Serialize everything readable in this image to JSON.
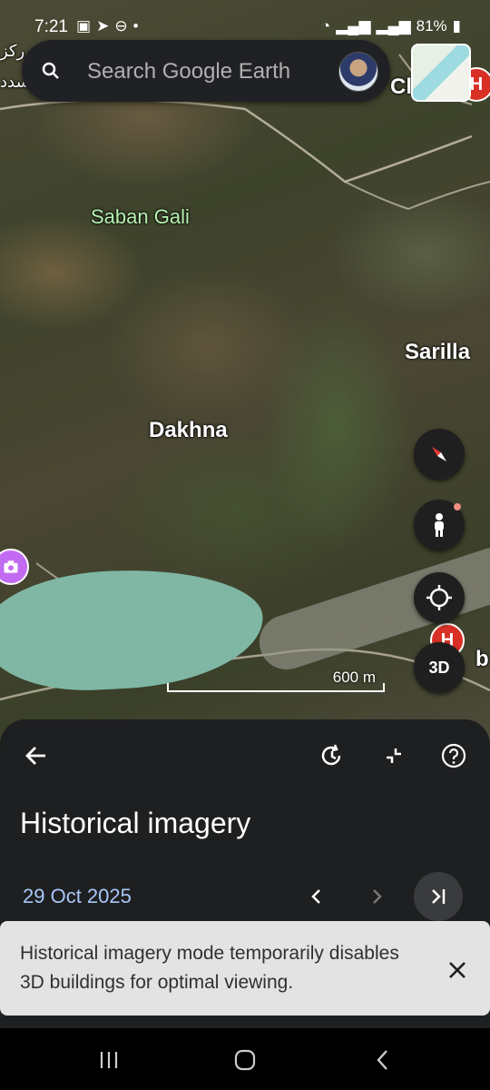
{
  "status_bar": {
    "time": "7:21",
    "battery": "81%"
  },
  "search": {
    "placeholder": "Search Google Earth"
  },
  "map": {
    "labels": {
      "saban_gali": "Saban Gali",
      "sarilla": "Sarilla",
      "dakhna": "Dakhna",
      "partial_top_right": "Cl",
      "partial_right": "b",
      "partial_urdu_1": "رکز",
      "partial_urdu_2": "سدد"
    },
    "scale_label": "600 m",
    "hospital_marker": "H",
    "button_3d": "3D"
  },
  "panel": {
    "title": "Historical imagery",
    "date": "29 Oct 2025"
  },
  "toast": {
    "message": "Historical imagery mode temporarily disables 3D buildings for optimal viewing."
  },
  "colors": {
    "panel_bg": "#1e1f20",
    "date_blue": "#a8c7fa",
    "hospital_red": "#d93025",
    "toast_bg": "#e3e3e3"
  }
}
